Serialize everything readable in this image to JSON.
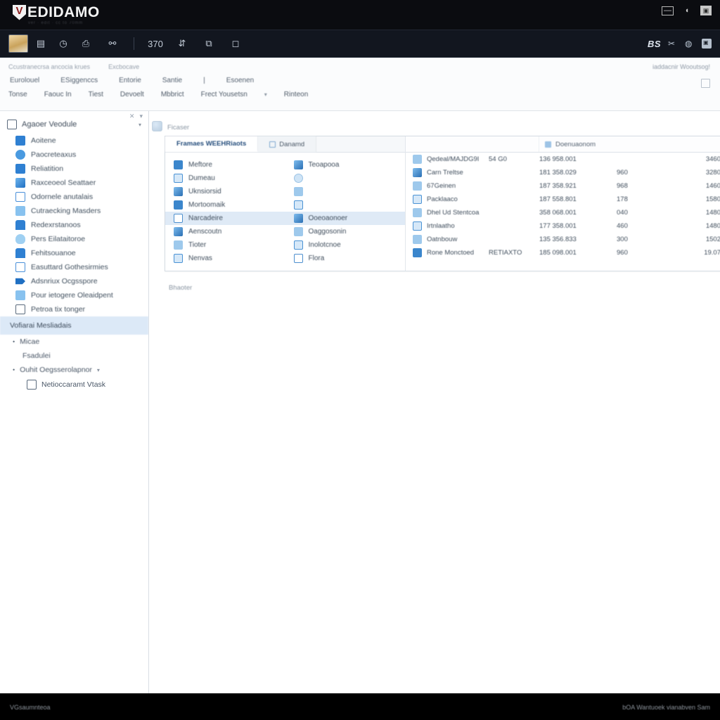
{
  "titlebar": {
    "logo_mark": "V",
    "logo_text": "EDIDAMO",
    "logo_sub": "ver  ·  edit  ·  cc      to     70mm",
    "window_controls": [
      {
        "name": "minimize-button",
        "glyph": "—"
      },
      {
        "name": "maximize-button",
        "glyph": "◖"
      },
      {
        "name": "restore-window-button",
        "glyph": "▣"
      }
    ]
  },
  "toolbar": {
    "items": [
      {
        "name": "image-tool-button",
        "glyph": ""
      },
      {
        "name": "document-tool-button",
        "glyph": "▤"
      },
      {
        "name": "clock-tool-button",
        "glyph": "◷"
      },
      {
        "name": "print-tool-button",
        "glyph": "⎙"
      },
      {
        "name": "link-tool-button",
        "glyph": "⚯"
      },
      {
        "name": "counter-tool-button",
        "glyph": "370"
      },
      {
        "name": "measure-tool-button",
        "glyph": "⇵"
      },
      {
        "name": "layers-tool-button",
        "glyph": "⧉"
      },
      {
        "name": "frame-tool-button",
        "glyph": "◻"
      }
    ],
    "right": {
      "label": "BS",
      "icons": [
        {
          "name": "scissors-icon",
          "glyph": "✂"
        },
        {
          "name": "globe-icon",
          "glyph": "◍"
        },
        {
          "name": "monitor-icon",
          "glyph": "▣"
        }
      ]
    }
  },
  "ribbon": {
    "breadcrumbs": [
      "Ccustranecrsa ancocia krues",
      "Excbocave"
    ],
    "menu_row_1": [
      "Eurolouel",
      "ESiggenccs",
      "Entorie",
      "Santie",
      "|",
      "Esoenen"
    ],
    "menu_row_2": [
      "Tonse",
      "Faouc In",
      "Tiest",
      "Devoelt",
      "Mbbrict",
      "Frect Yousetsn",
      "Rinteon"
    ],
    "dropdown_caret": "▾",
    "right_text": "iaddacnir Wooutsog!",
    "right_button": "panel-toggle-button"
  },
  "sidebar": {
    "controls": [
      "✕",
      "▾"
    ],
    "header": {
      "label": "Agaoer Veodule",
      "chevron": "▾"
    },
    "items": [
      {
        "label": "Aoitene",
        "icon": "b1"
      },
      {
        "label": "Paocreteaxus",
        "icon": "b2"
      },
      {
        "label": "Reliatition",
        "icon": "b1"
      },
      {
        "label": "Raxceoeol Seattaer",
        "icon": "b3"
      },
      {
        "label": "Odornele anutalais",
        "icon": "b6"
      },
      {
        "label": "Cutraecking Masders",
        "icon": "b5"
      },
      {
        "label": "Redexrstanoos",
        "icon": "b4"
      },
      {
        "label": "Pers Eilataitoroe",
        "icon": "b8"
      },
      {
        "label": "Fehitsouanoe",
        "icon": "b4"
      },
      {
        "label": "Easuttard Gothesirmies",
        "icon": "b6"
      },
      {
        "label": "Adsnriux Ocgsspore",
        "icon": "b7"
      },
      {
        "label": "Pour ietogere Oleaidpent",
        "icon": "b5"
      },
      {
        "label": "Petroa tix tonger",
        "icon": "doc"
      }
    ],
    "section_band": "Vofiarai Mesliadais",
    "bullets": [
      {
        "label": "Micae",
        "bullet": "•"
      },
      {
        "label": "Fsadulei",
        "bullet": ""
      },
      {
        "label": "Ouhit Oegsserolapnor",
        "bullet": "•",
        "caret": "▾"
      }
    ],
    "sub_item": {
      "label": "Netioccaramt Vtask",
      "icon": "doc"
    }
  },
  "content": {
    "panel_label": "Ficaser",
    "card": {
      "tabs": [
        {
          "label": "Framaes WEEHRiaots",
          "active": true
        },
        {
          "label": "Danamd",
          "active": false,
          "icon": "mini-box-icon"
        }
      ],
      "left_column": [
        {
          "label": "Meftore",
          "icon": "a"
        },
        {
          "label": "Dumeau",
          "icon": "b"
        },
        {
          "label": "Uknsiorsid",
          "icon": "c"
        },
        {
          "label": "Mortoomaik",
          "icon": "a"
        },
        {
          "label": "Narcadeire",
          "icon": "d",
          "highlighted": true
        },
        {
          "label": "Aenscoutn",
          "icon": "c"
        },
        {
          "label": "Tioter",
          "icon": "e"
        },
        {
          "label": "Nenvas",
          "icon": "b"
        }
      ],
      "right_column": [
        {
          "label": "Teoapooa",
          "icon": "c"
        },
        {
          "label": "",
          "icon": "f"
        },
        {
          "label": "",
          "icon": "e"
        },
        {
          "label": "",
          "icon": "b"
        },
        {
          "label": "Ooeoaonoer",
          "icon": "c",
          "highlighted": true
        },
        {
          "label": "Oaggosonin",
          "icon": "e"
        },
        {
          "label": "Inolotcnoe",
          "icon": "b"
        },
        {
          "label": "Flora",
          "icon": "d"
        }
      ],
      "table": {
        "header": {
          "label": "Doenuaonom",
          "right_control": "▾"
        },
        "columns": [
          "name",
          "code",
          "date",
          "value1",
          "value2",
          "more"
        ],
        "rows": [
          {
            "name": "Qedeal/MAJDG9I",
            "code": "54 G0",
            "date": "136 958.001",
            "v1": "",
            "v2": "3460",
            "more": "▾"
          },
          {
            "name": "Carn Treltse",
            "code": "",
            "date": "181 358.029",
            "v1": "960",
            "v2": "3280",
            "more": "▾"
          },
          {
            "name": "67Geinen",
            "code": "",
            "date": "187 358.921",
            "v1": "968",
            "v2": "1460",
            "more": "▾"
          },
          {
            "name": "Packlaaco",
            "code": "",
            "date": "187 558.801",
            "v1": "178",
            "v2": "1580",
            "more": "▾"
          },
          {
            "name": "Dhel Ud Stentcoa",
            "code": "",
            "date": "358 068.001",
            "v1": "040",
            "v2": "1480",
            "more": "▾"
          },
          {
            "name": "Irtnlaatho",
            "code": "",
            "date": "177 358.001",
            "v1": "460",
            "v2": "1480",
            "more": "▾"
          },
          {
            "name": "Oatnbouw",
            "code": "",
            "date": "135 356.833",
            "v1": "300",
            "v2": "1502",
            "more": "▾"
          },
          {
            "name": "Rone Monctoed",
            "code": "RETIAXTO",
            "date": "185 098.001",
            "v1": "960",
            "v2": "19.07",
            "more": "▾"
          }
        ]
      }
    },
    "footer_note": "Bhaoter"
  },
  "statusbar": {
    "left": "VGsaumnteoa",
    "right": "bOA Wantuoek vianabven Sam"
  },
  "colors": {
    "titlebar_bg": "#0b0c10",
    "toolbar_bg": "#12161f",
    "accent_blue": "#2f80d2",
    "selection_blue": "#dce9f7",
    "statusbar_bg": "#000000"
  }
}
